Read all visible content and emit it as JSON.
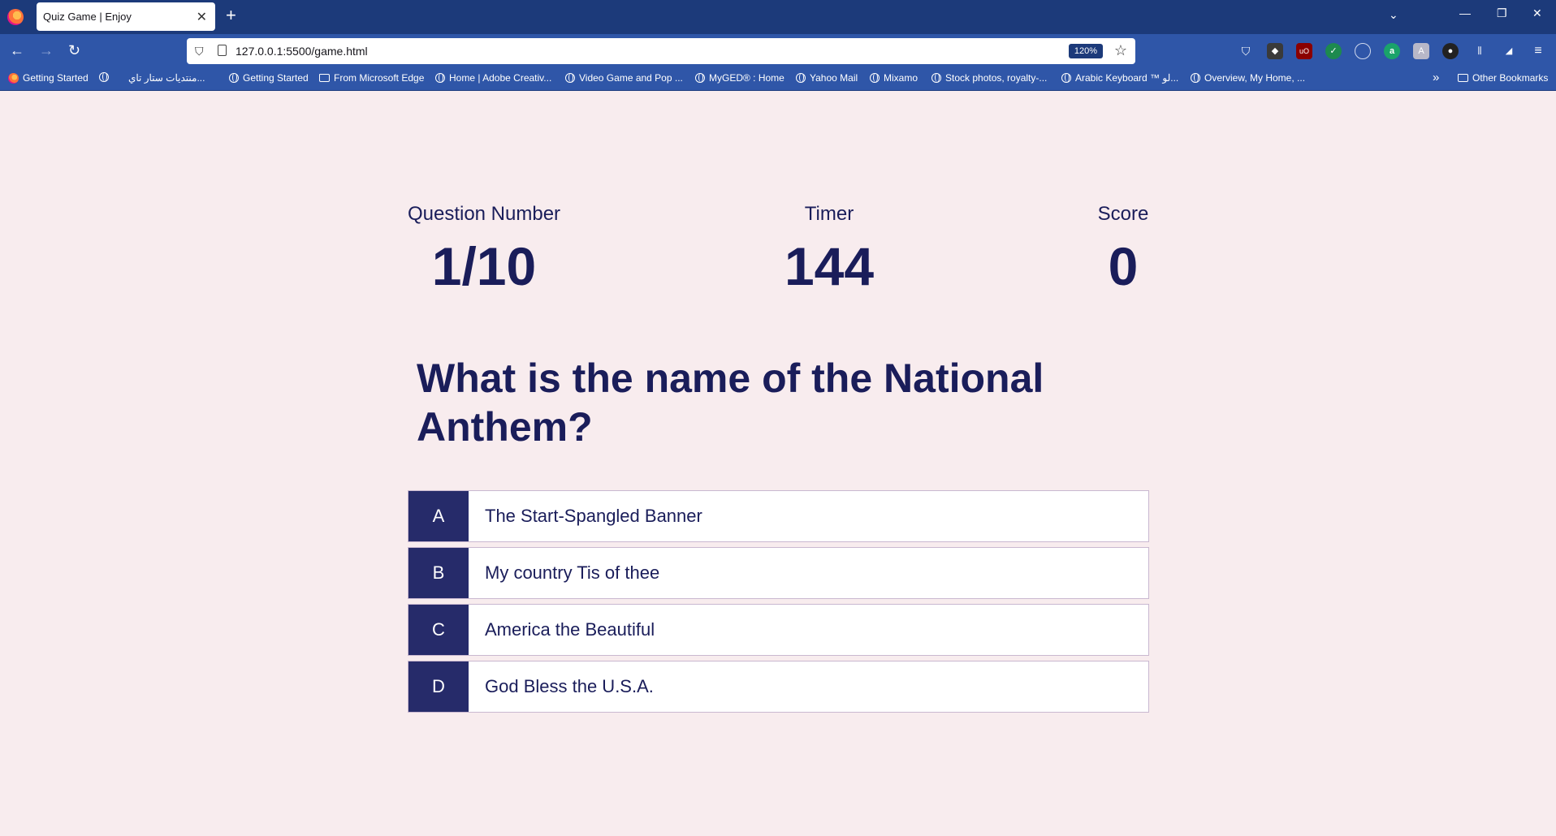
{
  "browser": {
    "tab_title": "Quiz Game | Enjoy",
    "url": "127.0.0.1:5500/game.html",
    "zoom": "120%",
    "bookmarks": [
      "Getting Started",
      "منتديات ستار تاي...",
      "Getting Started",
      "From Microsoft Edge",
      "Home | Adobe Creativ...",
      "Video Game and Pop ...",
      "MyGED® : Home",
      "Yahoo Mail",
      "Mixamo",
      "Stock photos, royalty-...",
      "Arabic Keyboard ™ لو...",
      "Overview, My Home, ...",
      "Other Bookmarks"
    ]
  },
  "hud": {
    "question_label": "Question Number",
    "question_value": "1/10",
    "timer_label": "Timer",
    "timer_value": "144",
    "score_label": "Score",
    "score_value": "0"
  },
  "question": "What is the name of the National Anthem?",
  "choices": [
    {
      "prefix": "A",
      "text": "The Start-Spangled Banner"
    },
    {
      "prefix": "B",
      "text": "My country Tis of thee"
    },
    {
      "prefix": "C",
      "text": "America the Beautiful"
    },
    {
      "prefix": "D",
      "text": "God Bless the U.S.A."
    }
  ],
  "colors": {
    "page_background": "#f8ecee",
    "accent": "#262b6a",
    "text": "#1a1d5a",
    "browser_tabbar": "#1c3a7a",
    "browser_toolbar": "#2f56a8"
  }
}
